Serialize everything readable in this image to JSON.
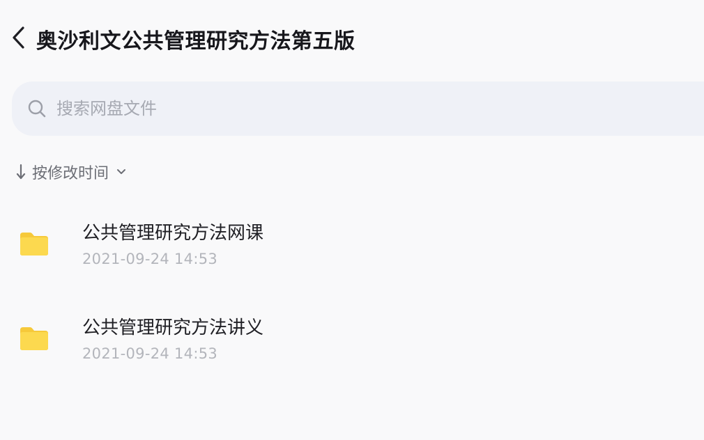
{
  "header": {
    "title": "奥沙利文公共管理研究方法第五版",
    "back_icon": "chevron-left-icon"
  },
  "search": {
    "placeholder": "搜索网盘文件",
    "value": "",
    "icon": "search-icon"
  },
  "sort": {
    "label": "按修改时间",
    "direction_icon": "arrow-down-icon",
    "dropdown_icon": "chevron-down-icon"
  },
  "files": [
    {
      "name": "公共管理研究方法网课",
      "modified": "2021-09-24 14:53",
      "type": "folder"
    },
    {
      "name": "公共管理研究方法讲义",
      "modified": "2021-09-24 14:53",
      "type": "folder"
    }
  ],
  "colors": {
    "folder": "#fcd94f",
    "folder_tab": "#f6c93a",
    "search_bg": "#eff1f7",
    "background": "#f9f9fa"
  }
}
